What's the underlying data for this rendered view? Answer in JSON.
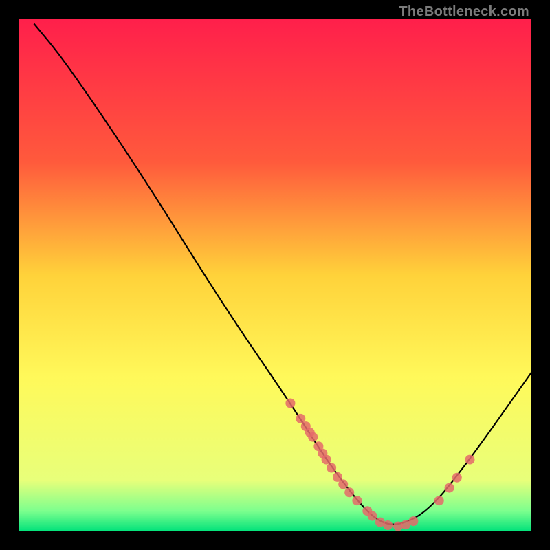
{
  "watermark": "TheBottleneck.com",
  "chart_data": {
    "type": "line",
    "title": "",
    "xlabel": "",
    "ylabel": "",
    "xlim": [
      0,
      100
    ],
    "ylim": [
      0,
      100
    ],
    "gradient_stops": [
      {
        "offset": 0,
        "color": "#ff1f4b"
      },
      {
        "offset": 28,
        "color": "#ff5a3c"
      },
      {
        "offset": 50,
        "color": "#ffd23a"
      },
      {
        "offset": 70,
        "color": "#fff95a"
      },
      {
        "offset": 90,
        "color": "#e8ff7a"
      },
      {
        "offset": 96,
        "color": "#7dff8e"
      },
      {
        "offset": 100,
        "color": "#00e27a"
      }
    ],
    "series": [
      {
        "name": "bottleneck-curve",
        "x": [
          3,
          8,
          15,
          25,
          40,
          53,
          60,
          66,
          70,
          74,
          80,
          88,
          100
        ],
        "y": [
          99,
          93,
          83,
          68,
          44,
          25,
          14,
          6,
          2,
          1,
          4,
          14,
          31
        ]
      }
    ],
    "marker_points": [
      {
        "x": 53.0,
        "y": 25.0
      },
      {
        "x": 55.0,
        "y": 22.0
      },
      {
        "x": 56.0,
        "y": 20.5
      },
      {
        "x": 56.8,
        "y": 19.3
      },
      {
        "x": 57.4,
        "y": 18.4
      },
      {
        "x": 58.5,
        "y": 16.6
      },
      {
        "x": 59.3,
        "y": 15.2
      },
      {
        "x": 60.0,
        "y": 14.0
      },
      {
        "x": 61.0,
        "y": 12.4
      },
      {
        "x": 62.2,
        "y": 10.6
      },
      {
        "x": 63.3,
        "y": 9.2
      },
      {
        "x": 64.5,
        "y": 7.6
      },
      {
        "x": 66.0,
        "y": 6.0
      },
      {
        "x": 68.0,
        "y": 4.0
      },
      {
        "x": 69.0,
        "y": 3.0
      },
      {
        "x": 70.5,
        "y": 1.8
      },
      {
        "x": 72.0,
        "y": 1.2
      },
      {
        "x": 74.0,
        "y": 1.0
      },
      {
        "x": 75.5,
        "y": 1.3
      },
      {
        "x": 77.0,
        "y": 2.0
      },
      {
        "x": 82.0,
        "y": 6.0
      },
      {
        "x": 84.0,
        "y": 8.5
      },
      {
        "x": 85.5,
        "y": 10.5
      },
      {
        "x": 88.0,
        "y": 14.0
      }
    ],
    "marker_color": "#e46a6a",
    "curve_color": "#000000"
  }
}
